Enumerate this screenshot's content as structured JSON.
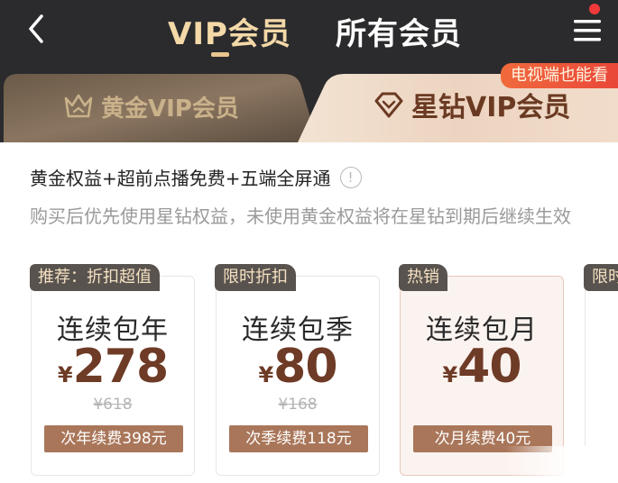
{
  "nav": {
    "back_icon": "chevron-left-icon",
    "tabs": [
      {
        "label": "VIP会员",
        "active": true
      },
      {
        "label": "所有会员",
        "active": false
      }
    ],
    "menu_icon": "hamburger-menu-icon",
    "has_notification_dot": true
  },
  "tiers": {
    "gold": {
      "label": "黄金VIP会员",
      "icon": "crown-icon"
    },
    "star": {
      "label": "星钻VIP会员",
      "icon": "diamond-icon",
      "badge": "电视端也能看"
    }
  },
  "description": {
    "title": "黄金权益+超前点播免费+五端全屏通",
    "info_icon": "info-circle-icon",
    "subtitle": "购买后优先使用星钻权益，未使用黄金权益将在星钻到期后继续生效"
  },
  "plans": [
    {
      "tag": "推荐：折扣超值",
      "name": "连续包年",
      "currency": "¥",
      "price": "278",
      "original": "¥618",
      "renew": "次年续费398元",
      "selected": false
    },
    {
      "tag": "限时折扣",
      "name": "连续包季",
      "currency": "¥",
      "price": "80",
      "original": "¥168",
      "renew": "次季续费118元",
      "selected": false
    },
    {
      "tag": "热销",
      "name": "连续包月",
      "currency": "¥",
      "price": "40",
      "original": "",
      "renew": "次月续费40元",
      "selected": true
    },
    {
      "tag": "限时",
      "name": "",
      "currency": "",
      "price": "",
      "original": "",
      "renew": "",
      "selected": false
    }
  ],
  "colors": {
    "bar_bg": "#2b2b2d",
    "active_tab": "#f4d9a8",
    "brown_accent": "#6e3b26",
    "renew_button": "#a9765a",
    "badge_red": "#e9473a"
  }
}
